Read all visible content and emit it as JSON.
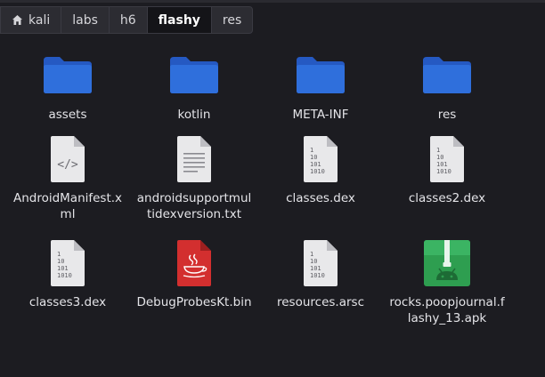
{
  "pathbar": {
    "crumbs": [
      "kali",
      "labs",
      "h6",
      "flashy",
      "res"
    ],
    "active": "flashy"
  },
  "files": [
    {
      "name": "assets",
      "type": "folder",
      "icon": "folder-icon"
    },
    {
      "name": "kotlin",
      "type": "folder",
      "icon": "folder-icon"
    },
    {
      "name": "META-INF",
      "type": "folder",
      "icon": "folder-icon"
    },
    {
      "name": "res",
      "type": "folder",
      "icon": "folder-icon"
    },
    {
      "name": "AndroidManifest.xml",
      "type": "xml",
      "icon": "xml-file-icon"
    },
    {
      "name": "androidsupportmultidexversion.txt",
      "type": "text",
      "icon": "text-file-icon"
    },
    {
      "name": "classes.dex",
      "type": "binary",
      "icon": "binary-file-icon"
    },
    {
      "name": "classes2.dex",
      "type": "binary",
      "icon": "binary-file-icon"
    },
    {
      "name": "classes3.dex",
      "type": "binary",
      "icon": "binary-file-icon"
    },
    {
      "name": "DebugProbesKt.bin",
      "type": "java",
      "icon": "java-file-icon"
    },
    {
      "name": "resources.arsc",
      "type": "binary",
      "icon": "binary-file-icon"
    },
    {
      "name": "rocks.poopjournal.flashy_13.apk",
      "type": "apk",
      "icon": "android-package-icon"
    }
  ],
  "colors": {
    "background": "#1c1c21",
    "folder": "#2f6fdc",
    "java": "#d32f2f",
    "apk": "#2e9e50"
  }
}
